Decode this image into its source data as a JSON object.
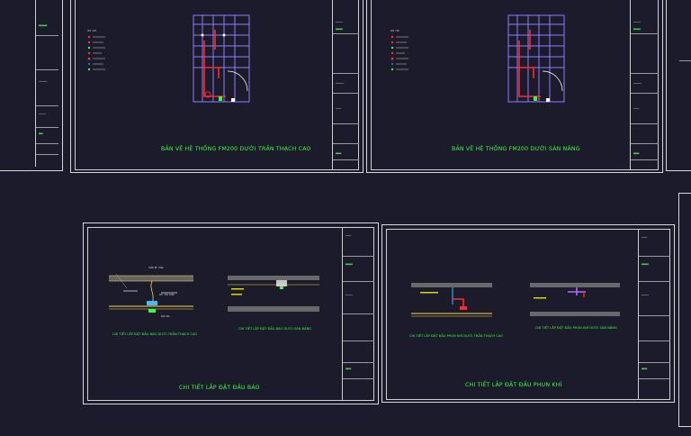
{
  "sheets": {
    "fm200_ceiling": {
      "title": "BẢN VẼ HỆ THỐNG FM200 DƯỚI TRẦN THẠCH CAO",
      "legend_heading": "GHI CHÚ"
    },
    "fm200_floor": {
      "title": "BẢN VẼ HỆ THỐNG FM200 DƯỚI SÀN NÂNG",
      "legend_heading": "GHI CHÚ"
    },
    "detector_detail": {
      "title": "CHI TIẾT LẮP ĐẶT ĐẦU BÁO",
      "caption_left": "CHI TIẾT LẮP ĐẶT ĐẦU BÁO DƯỚI TRẦN THẠCH CAO",
      "caption_right": "CHI TIẾT LẮP ĐẶT ĐẦU BÁO DƯỚI SÀN NÂNG",
      "callout_left": "TRẦN BÊ TÔNG",
      "callout_mid": "DÂY TÍN HIỆU",
      "callout_bottom": "ĐẦU BÁO"
    },
    "nozzle_detail": {
      "title": "CHI TIẾT LẮP ĐẶT ĐẦU PHUN KHÍ",
      "caption_left": "CHI TIẾT LẮP ĐẶT ĐẦU PHUN KHÍ DƯỚI TRẦN THẠCH CAO",
      "caption_right": "CHI TIẾT LẮP ĐẶT ĐẦU PHUN KHÍ DƯỚI SÀN NÂNG"
    }
  },
  "colors": {
    "background": "#1b1b2b",
    "frame": "#d8d8d8",
    "title_green": "#3cff3c",
    "wall": "#8c7cff",
    "pipe": "#ff2a2a"
  }
}
